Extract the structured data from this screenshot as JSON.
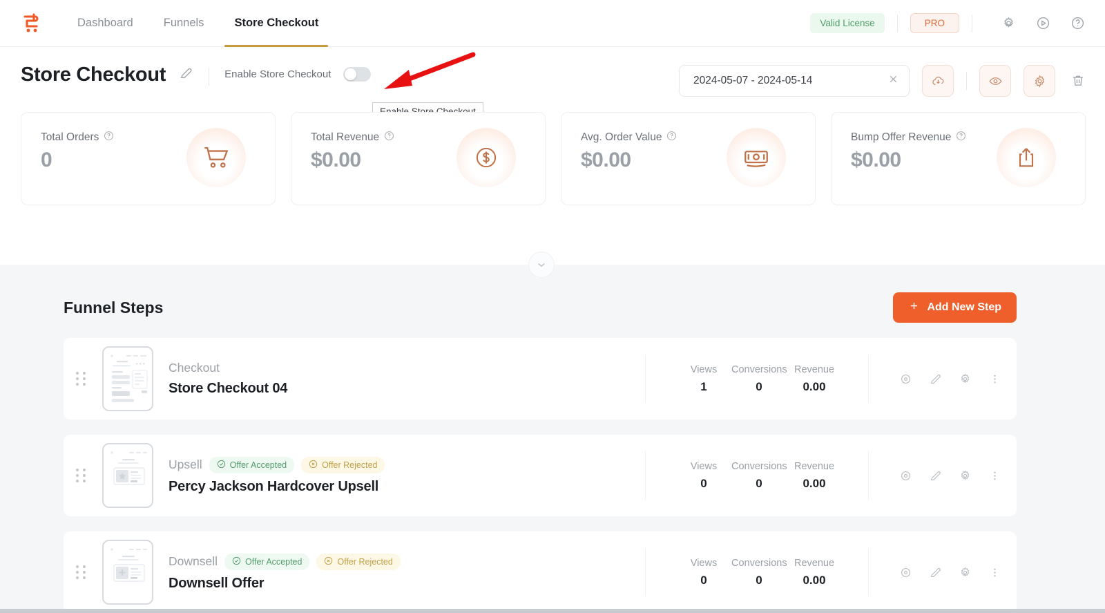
{
  "nav": {
    "logo_icon": "cartflows-logo-icon",
    "items": [
      {
        "label": "Dashboard",
        "active": false
      },
      {
        "label": "Funnels",
        "active": false
      },
      {
        "label": "Store Checkout",
        "active": true
      }
    ],
    "license_badge": "Valid License",
    "plan_badge": "PRO",
    "icons": [
      "gear-icon",
      "play-circle-icon",
      "help-circle-icon"
    ],
    "active_underline_color": "#c79a3c"
  },
  "header": {
    "title": "Store Checkout",
    "edit_icon": "pencil-edit-icon",
    "enable_label": "Enable Store Checkout",
    "toggle_on": false,
    "tooltip": "Enable Store Checkout",
    "date_range": "2024-05-07 - 2024-05-14",
    "date_clear_icon": "close-icon",
    "actions": [
      "cloud-download-icon",
      "eye-icon",
      "gear-icon"
    ],
    "delete_icon": "trash-icon"
  },
  "kpis": [
    {
      "label": "Total Orders",
      "value": "0",
      "icon": "shopping-cart-icon",
      "help": "?"
    },
    {
      "label": "Total Revenue",
      "value": "$0.00",
      "icon": "dollar-circle-icon",
      "help": "?"
    },
    {
      "label": "Avg. Order Value",
      "value": "$0.00",
      "icon": "banknote-icon",
      "help": "?"
    },
    {
      "label": "Bump Offer Revenue",
      "value": "$0.00",
      "icon": "share-upload-icon",
      "help": "?"
    }
  ],
  "funnel": {
    "collapse_icon": "chevron-down-icon",
    "section_title": "Funnel Steps",
    "add_button": "Add New Step",
    "add_icon": "plus-icon",
    "stat_headers": [
      "Views",
      "Conversions",
      "Revenue"
    ],
    "row_actions": [
      "eye-icon",
      "pencil-icon",
      "gear-icon",
      "more-vertical-icon"
    ],
    "steps": [
      {
        "type": "Checkout",
        "name": "Store Checkout 04",
        "badges": [],
        "views": "1",
        "conversions": "0",
        "revenue": "0.00",
        "thumb": "checkout"
      },
      {
        "type": "Upsell",
        "name": "Percy Jackson Hardcover Upsell",
        "badges": [
          {
            "label": "Offer Accepted",
            "kind": "accepted",
            "icon": "check-circle-icon"
          },
          {
            "label": "Offer Rejected",
            "kind": "rejected",
            "icon": "x-circle-icon"
          }
        ],
        "views": "0",
        "conversions": "0",
        "revenue": "0.00",
        "thumb": "offer-star"
      },
      {
        "type": "Downsell",
        "name": "Downsell Offer",
        "badges": [
          {
            "label": "Offer Accepted",
            "kind": "accepted",
            "icon": "check-circle-icon"
          },
          {
            "label": "Offer Rejected",
            "kind": "rejected",
            "icon": "x-circle-icon"
          }
        ],
        "views": "0",
        "conversions": "0",
        "revenue": "0.00",
        "thumb": "offer-plus"
      }
    ]
  },
  "annotation": {
    "type": "red-arrow",
    "color": "#e81111"
  }
}
